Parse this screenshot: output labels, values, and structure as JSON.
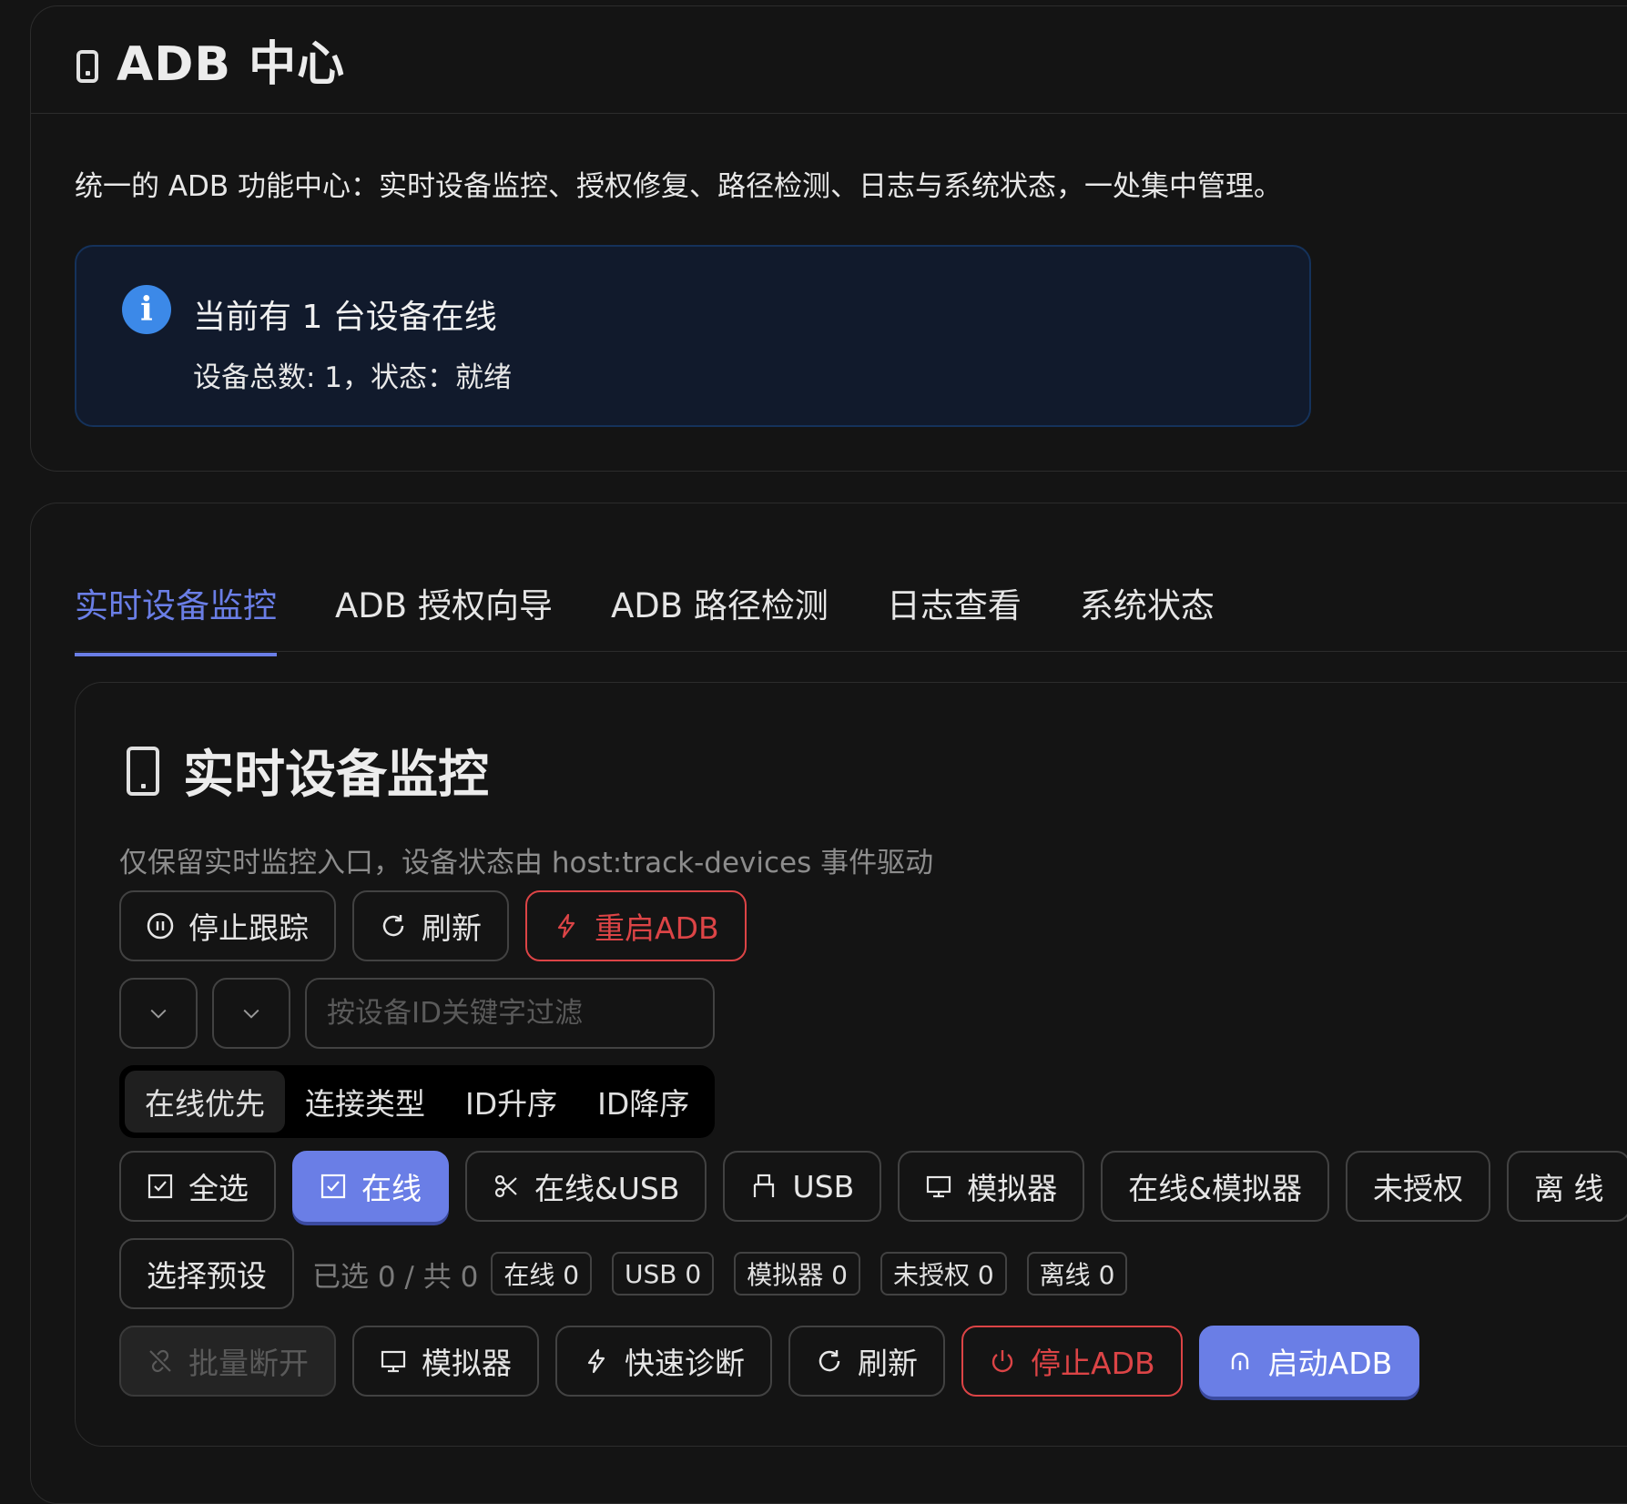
{
  "header": {
    "title": "ADB 中心",
    "description": "统一的 ADB 功能中心：实时设备监控、授权修复、路径检测、日志与系统状态，一处集中管理。"
  },
  "alert": {
    "message": "当前有 1 台设备在线",
    "detail": "设备总数: 1，状态：就绪",
    "icon_glyph": "i"
  },
  "tabs": [
    "实时设备监控",
    "ADB 授权向导",
    "ADB 路径检测",
    "日志查看",
    "系统状态"
  ],
  "monitor": {
    "title": "实时设备监控",
    "description": "仅保留实时监控入口，设备状态由 host:track-devices 事件驱动",
    "actions": {
      "stop_tracking": "停止跟踪",
      "refresh": "刷新",
      "restart_adb": "重启ADB"
    },
    "filter_placeholder": "按设备ID关键字过滤",
    "sort_options": [
      "在线优先",
      "连接类型",
      "ID升序",
      "ID降序"
    ],
    "select_buttons": [
      "全选",
      "在线",
      "在线&USB",
      "USB",
      "模拟器",
      "在线&模拟器",
      "未授权",
      "离 线"
    ],
    "preset_label": "选择预设",
    "selection_count": "已选 0 / 共 0",
    "tags": [
      "在线 0",
      "USB 0",
      "模拟器 0",
      "未授权 0",
      "离线 0"
    ],
    "bottom_actions": {
      "batch_disconnect": "批量断开",
      "emulator": "模拟器",
      "quick_diagnose": "快速诊断",
      "refresh": "刷新",
      "stop_adb": "停止ADB",
      "start_adb": "启动ADB"
    }
  },
  "colors": {
    "accent": "#6a7ee6",
    "danger": "#dc4446",
    "info": "#3c89e8",
    "background": "#141414"
  }
}
